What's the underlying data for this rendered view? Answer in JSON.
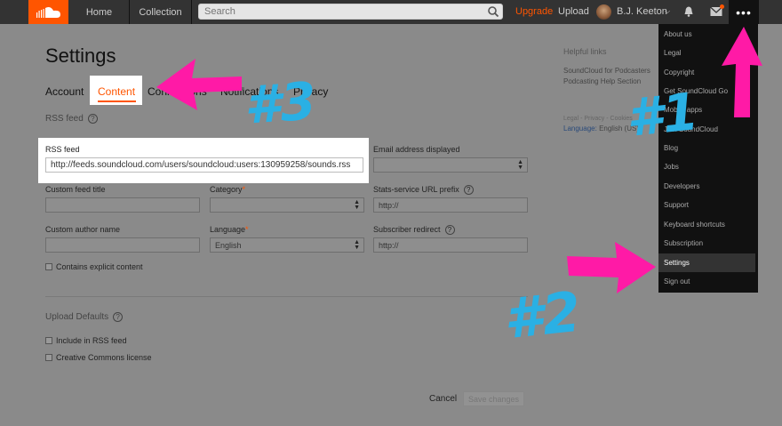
{
  "topbar": {
    "home": "Home",
    "collection": "Collection",
    "search_placeholder": "Search",
    "upgrade": "Upgrade",
    "upload": "Upload",
    "user_name": "B.J. Keeton",
    "more": "•••"
  },
  "page": {
    "title": "Settings",
    "tabs": [
      "Account",
      "Content",
      "Connections",
      "Notifications",
      "Privacy"
    ]
  },
  "form": {
    "rss_section": "RSS feed",
    "rss_label": "RSS feed",
    "rss_value": "http://feeds.soundcloud.com/users/soundcloud:users:130959258/sounds.rss",
    "email_label": "Email address displayed",
    "custom_title_label": "Custom feed title",
    "category_label": "Category",
    "stats_label": "Stats-service URL prefix",
    "stats_placeholder": "http://",
    "author_label": "Custom author name",
    "language_label": "Language",
    "language_value": "English",
    "redirect_label": "Subscriber redirect",
    "redirect_placeholder": "http://",
    "explicit_label": "Contains explicit content",
    "upload_section": "Upload Defaults",
    "include_rss_label": "Include in RSS feed",
    "cc_label": "Creative Commons license",
    "cancel": "Cancel",
    "save": "Save changes"
  },
  "sidebar": {
    "heading": "Helpful links",
    "links": [
      "SoundCloud for Podcasters",
      "Podcasting Help Section"
    ],
    "legal": "Legal - Privacy - Cookies",
    "language_key": "Language:",
    "language_value": "English (US)"
  },
  "menu": {
    "items": [
      "About us",
      "Legal",
      "Copyright",
      "Get SoundCloud Go",
      "Mobile apps",
      "Join SoundCloud",
      "Blog",
      "Jobs",
      "Developers",
      "Support",
      "Keyboard shortcuts",
      "Subscription",
      "Settings",
      "Sign out"
    ],
    "active": "Settings"
  },
  "annotations": {
    "one": "#1",
    "two": "#2",
    "three": "#3",
    "arrow_color": "#ff1aa6",
    "text_color": "#2ab0e4"
  }
}
